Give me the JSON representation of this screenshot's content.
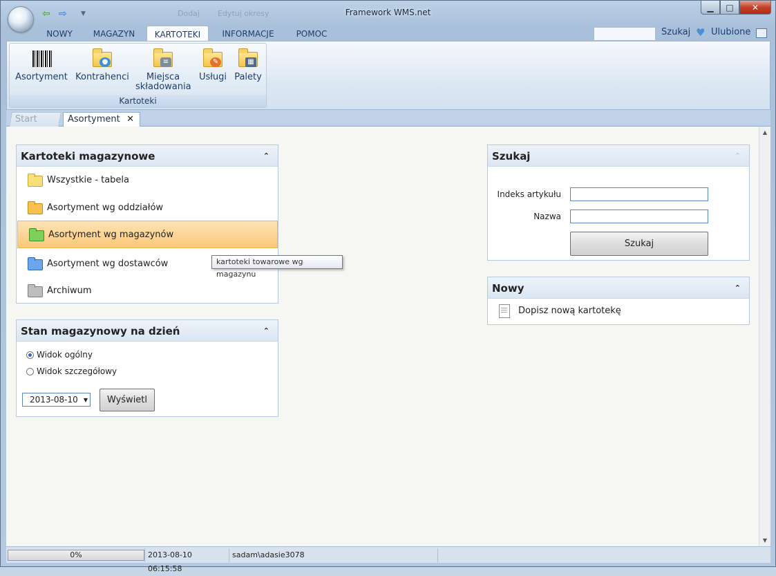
{
  "window": {
    "title": "Framework WMS.net",
    "quick_access": {
      "ghost_1": "Dodaj",
      "ghost_2": "Edytuj okresy"
    }
  },
  "menu": {
    "tabs": [
      {
        "label": "NOWY"
      },
      {
        "label": "MAGAZYN"
      },
      {
        "label": "KARTOTEKI",
        "active": true
      },
      {
        "label": "INFORMACJE"
      },
      {
        "label": "POMOC"
      }
    ],
    "search_link": "Szukaj",
    "favorites_link": "Ulubione"
  },
  "ribbon": {
    "group_label": "Kartoteki",
    "buttons": [
      {
        "label": "Asortyment",
        "icon": "barcode-icon"
      },
      {
        "label": "Kontrahenci",
        "icon": "contacts-folder-icon"
      },
      {
        "label": "Miejsca składowania",
        "label_line1": "Miejsca",
        "label_line2": "składowania",
        "icon": "storage-folder-icon"
      },
      {
        "label": "Usługi",
        "icon": "services-folder-icon"
      },
      {
        "label": "Palety",
        "icon": "pallets-folder-icon"
      }
    ]
  },
  "doc_tabs": [
    {
      "label": "Start",
      "active": false
    },
    {
      "label": "Asortyment",
      "active": true
    }
  ],
  "kartoteki_panel": {
    "title": "Kartoteki magazynowe",
    "items": [
      {
        "label": "Wszystkie - tabela",
        "color": "#f7d95a"
      },
      {
        "label": "Asortyment wg oddziałów",
        "color": "#f5b53c"
      },
      {
        "label": "Asortyment wg magazynów",
        "color": "#6cc54a",
        "selected": true
      },
      {
        "label": "Asortyment wg dostawców",
        "color": "#4f8fe0"
      },
      {
        "label": "Archiwum",
        "color": "#a6a6a6"
      }
    ],
    "tooltip": "kartoteki towarowe wg magazynu"
  },
  "stan_panel": {
    "title": "Stan magazynowy na dzień",
    "radio_general": "Widok ogólny",
    "radio_detailed": "Widok szczegółowy",
    "selected_view": "general",
    "date_value": "2013-08-10",
    "show_button": "Wyświetl"
  },
  "search_panel": {
    "title": "Szukaj",
    "index_label": "Indeks artykułu",
    "name_label": "Nazwa",
    "index_value": "",
    "name_value": "",
    "search_button": "Szukaj"
  },
  "new_panel": {
    "title": "Nowy",
    "add_link": "Dopisz nową kartotekę"
  },
  "status_bar": {
    "progress_text": "0%",
    "progress_value": 0,
    "datetime": "2013-08-10 06:15:58",
    "user": "sadam\\adasie3078"
  },
  "colors": {
    "accent": "#1f3d67",
    "selection": "#fbc877",
    "window_frame": "#bcd0e6"
  }
}
